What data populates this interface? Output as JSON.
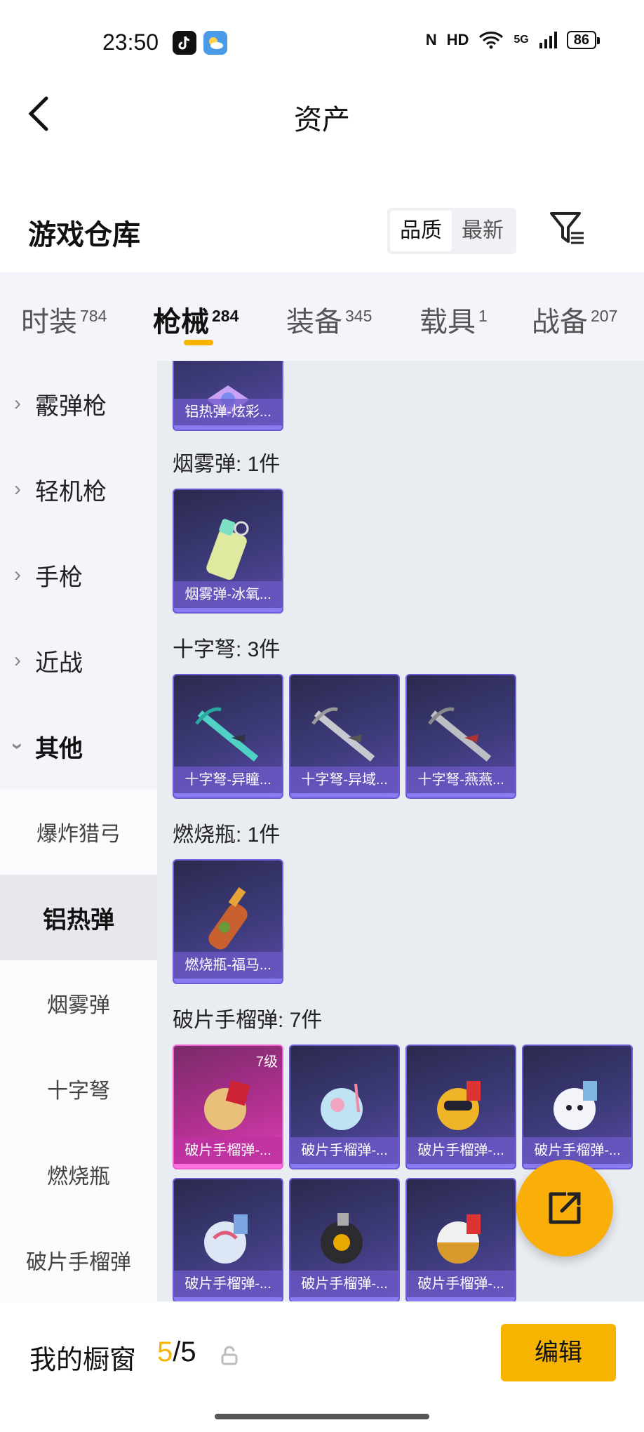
{
  "status": {
    "time": "23:50",
    "network": "5G",
    "battery": "86"
  },
  "header": {
    "title": "资产"
  },
  "warehouse": {
    "title": "游戏仓库",
    "sort_options": [
      "品质",
      "最新"
    ],
    "sort_selected": "品质"
  },
  "tabs": [
    {
      "label": "时装",
      "count": "784"
    },
    {
      "label": "枪械",
      "count": "284",
      "active": true
    },
    {
      "label": "装备",
      "count": "345"
    },
    {
      "label": "载具",
      "count": "1"
    },
    {
      "label": "战备",
      "count": "207"
    }
  ],
  "sidebar": {
    "categories": [
      "霰弹枪",
      "轻机枪",
      "手枪",
      "近战",
      "其他"
    ],
    "subcategories": [
      "爆炸猎弓",
      "铝热弹",
      "烟雾弹",
      "十字弩",
      "燃烧瓶",
      "破片手榴弹"
    ],
    "active_sub": "铝热弹"
  },
  "groups": {
    "top_card": "铝热弹-炫彩...",
    "smoke": {
      "title": "烟雾弹: 1件",
      "items": [
        "烟雾弹-冰氧..."
      ]
    },
    "crossbow": {
      "title": "十字弩: 3件",
      "items": [
        "十字弩-异瞳...",
        "十字弩-异域...",
        "十字弩-燕燕..."
      ]
    },
    "molotov": {
      "title": "燃烧瓶: 1件",
      "items": [
        "燃烧瓶-福马..."
      ]
    },
    "grenade": {
      "title": "破片手榴弹: 7件",
      "level": "7级",
      "items": [
        "破片手榴弹-...",
        "破片手榴弹-...",
        "破片手榴弹-...",
        "破片手榴弹-...",
        "破片手榴弹-...",
        "破片手榴弹-...",
        "破片手榴弹-..."
      ]
    }
  },
  "bottom": {
    "title": "我的橱窗",
    "current": "5",
    "separator": "/",
    "total": "5",
    "edit_label": "编辑"
  },
  "colors": {
    "accent": "#f6b400",
    "fab": "#f9ae0a",
    "card_border": "#6b5bd6",
    "card_highlight": "#e040b8"
  }
}
